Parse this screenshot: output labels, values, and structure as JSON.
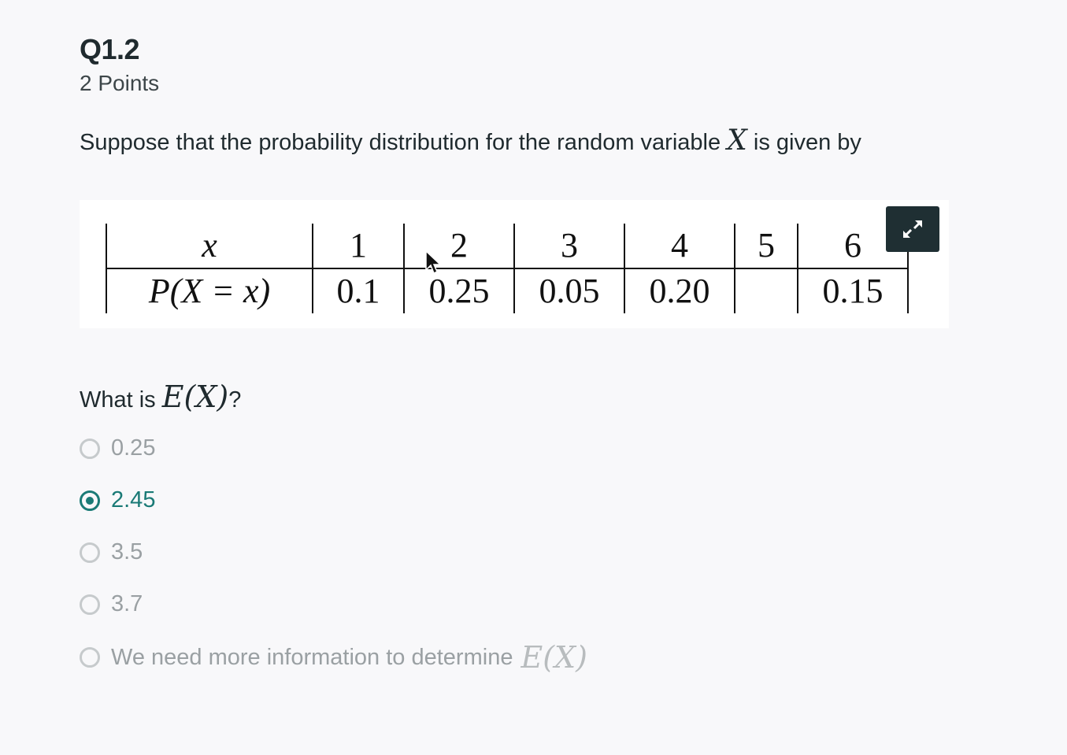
{
  "question": {
    "number": "Q1.2",
    "points": "2 Points",
    "prompt_text": "Suppose that the probability distribution for the random variable",
    "prompt_var": "X",
    "prompt_tail": "is given by"
  },
  "table": {
    "x_header": "x",
    "p_header": "P(X = x)",
    "x_values": [
      "1",
      "2",
      "3",
      "4",
      "5",
      "6"
    ],
    "p_values": [
      "0.1",
      "0.25",
      "0.05",
      "0.20",
      "",
      "0.15"
    ],
    "expand_icon": "expand-arrows-icon"
  },
  "sub_question": {
    "text": "What is",
    "math": "E(X)",
    "tail": "?"
  },
  "options": [
    {
      "label": "0.25",
      "selected": false
    },
    {
      "label": "2.45",
      "selected": true
    },
    {
      "label": "3.5",
      "selected": false
    },
    {
      "label": "3.7",
      "selected": false
    },
    {
      "label": "We need more information to determine",
      "math": "E(X)",
      "selected": false
    }
  ],
  "colors": {
    "accent": "#1a7a76",
    "text": "#1f2a2e",
    "muted": "#9aa0a3",
    "expand_button": "#1f2f33"
  }
}
